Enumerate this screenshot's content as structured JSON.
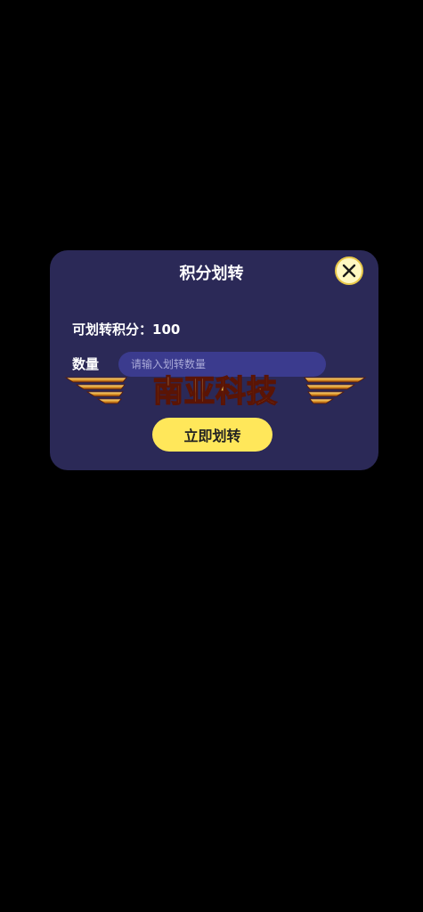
{
  "dialog": {
    "title": "积分划转",
    "available_points": "可划转积分：100",
    "quantity_label": "数量",
    "quantity_placeholder": "请输入划转数量",
    "quantity_value": "",
    "submit_label": "立即划转",
    "close_icon": "close-icon"
  },
  "watermark": {
    "text": "南亚科技"
  },
  "colors": {
    "background": "#000000",
    "dialog": "#2b2957",
    "input": "#3b3b8e",
    "button": "#ffe75a",
    "close": "#fff8c2"
  }
}
